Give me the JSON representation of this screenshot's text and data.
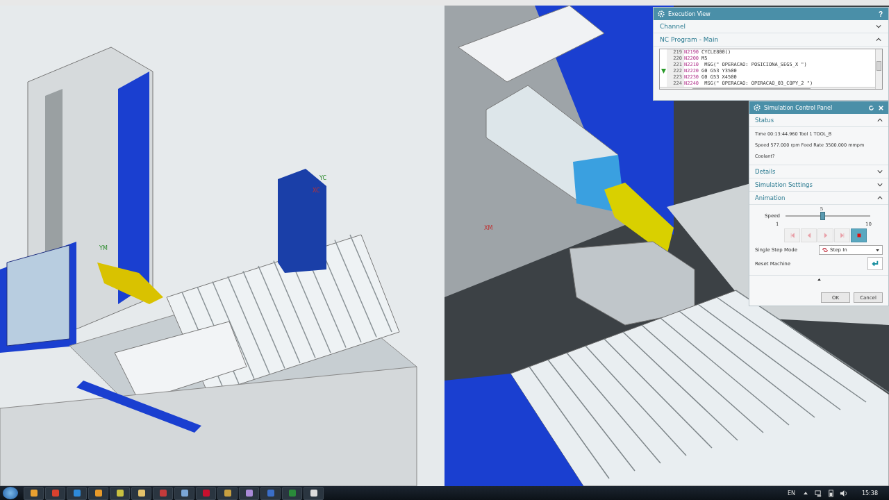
{
  "left_view": {
    "axis_labels": [
      "YC",
      "XC",
      "YM"
    ]
  },
  "right_view": {
    "axis_labels": [
      "XM"
    ]
  },
  "execution_view": {
    "title": "Execution View",
    "help": "?",
    "channel": {
      "label": "Channel",
      "expanded": false
    },
    "nc_program": {
      "label": "NC Program - Main",
      "expanded": true,
      "lines": [
        {
          "number": "219",
          "block": "N2190",
          "code": "CYCLE800()",
          "current": false
        },
        {
          "number": "220",
          "block": "N2200",
          "code": "M5",
          "current": false
        },
        {
          "number": "221",
          "block": "N2210",
          "code": " MSG(\" OPERACAO: POSICIONA_SEG5_X \")",
          "current": false
        },
        {
          "number": "222",
          "block": "N2220",
          "code": "G0 G53 Y3500",
          "current": true
        },
        {
          "number": "223",
          "block": "N2230",
          "code": "G0 G53 X4500",
          "current": false
        },
        {
          "number": "224",
          "block": "N2240",
          "code": " MSG(\" OPERACAO: OPERACAO_03_COPY_2 \")",
          "current": false
        }
      ]
    }
  },
  "sim_panel": {
    "title": "Simulation Control Panel",
    "status": {
      "label": "Status",
      "expanded": true,
      "lines": [
        "Time 00:13:44.960   Tool 1   TOOL_B",
        "Speed 577.000 rpm Feed Rate 3500.000 mmpm",
        "Coolant?"
      ]
    },
    "details": {
      "label": "Details",
      "expanded": false
    },
    "settings": {
      "label": "Simulation Settings",
      "expanded": false
    },
    "animation": {
      "label": "Animation",
      "expanded": true,
      "speed_label": "Speed",
      "speed_value": "5",
      "speed_min": "1",
      "speed_max": "10",
      "level": 0.444,
      "controls": [
        {
          "kind": "first",
          "selected": false
        },
        {
          "kind": "back",
          "selected": false
        },
        {
          "kind": "play",
          "selected": false
        },
        {
          "kind": "last",
          "selected": false
        },
        {
          "kind": "stop",
          "selected": true
        }
      ],
      "step_mode_label": "Single Step Mode",
      "step_mode_value": "Step In",
      "reset_label": "Reset Machine"
    },
    "buttons": [
      "OK",
      "Cancel"
    ]
  },
  "taskbar": {
    "apps": [
      {
        "kind": "mail"
      },
      {
        "kind": "chrome"
      },
      {
        "kind": "ie"
      },
      {
        "kind": "media"
      },
      {
        "kind": "notes"
      },
      {
        "kind": "folder"
      },
      {
        "kind": "paint"
      },
      {
        "kind": "cube"
      },
      {
        "kind": "acrobat"
      },
      {
        "kind": "grid"
      },
      {
        "kind": "doc"
      },
      {
        "kind": "nx"
      },
      {
        "kind": "excel"
      },
      {
        "kind": "window"
      }
    ],
    "language": "EN",
    "clock": "15:38"
  }
}
